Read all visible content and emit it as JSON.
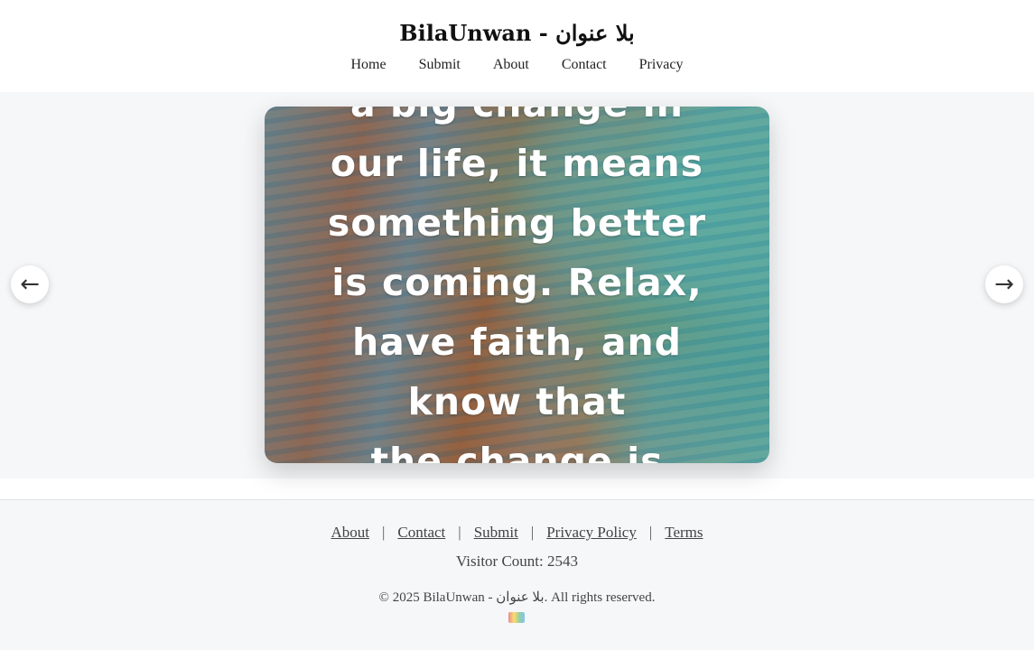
{
  "header": {
    "title": "BilaUnwan - بلا عنوان",
    "nav": [
      "Home",
      "Submit",
      "About",
      "Contact",
      "Privacy"
    ]
  },
  "slider": {
    "quote_lines": "a big change in\nour life, it means\nsomething better\nis coming. Relax,\nhave faith, and\nknow that\nthe change is",
    "prev_icon": "←",
    "next_icon": "→",
    "icons": [
      "arrow-left-icon",
      "arrow-right-icon"
    ]
  },
  "footer": {
    "links": [
      "About",
      "Contact",
      "Submit",
      "Privacy Policy",
      "Terms"
    ],
    "separator": "|",
    "visitor_count": "Visitor Count: 2543",
    "copyright": "© 2025 BilaUnwan - بلا عنوان. All rights reserved."
  },
  "colors": {
    "page_background": "#f6f7f9",
    "header_background": "#ffffff",
    "quote_text": "#ffffff"
  }
}
